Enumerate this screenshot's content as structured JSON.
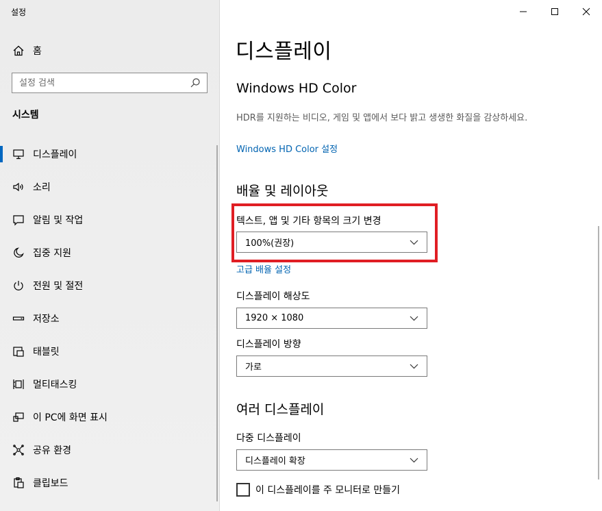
{
  "window": {
    "title": "설정"
  },
  "sidebar": {
    "home_label": "홈",
    "search_placeholder": "설정 검색",
    "section_title": "시스템",
    "items": [
      {
        "label": "디스플레이",
        "icon": "monitor-icon",
        "active": true
      },
      {
        "label": "소리",
        "icon": "speaker-icon"
      },
      {
        "label": "알림 및 작업",
        "icon": "notification-icon"
      },
      {
        "label": "집중 지원",
        "icon": "moon-icon"
      },
      {
        "label": "전원 및 절전",
        "icon": "power-icon"
      },
      {
        "label": "저장소",
        "icon": "storage-icon"
      },
      {
        "label": "태블릿",
        "icon": "tablet-icon"
      },
      {
        "label": "멀티태스킹",
        "icon": "multitasking-icon"
      },
      {
        "label": "이 PC에 화면 표시",
        "icon": "project-icon"
      },
      {
        "label": "공유 환경",
        "icon": "shared-experiences-icon"
      },
      {
        "label": "클립보드",
        "icon": "clipboard-icon"
      }
    ]
  },
  "main": {
    "page_title": "디스플레이",
    "hd_color": {
      "header": "Windows HD Color",
      "description": "HDR를 지원하는 비디오, 게임 및 앱에서 보다 밝고 생생한 화질을 감상하세요.",
      "link": "Windows HD Color 설정"
    },
    "scale_layout": {
      "header": "배율 및 레이아웃",
      "scale_label": "텍스트, 앱 및 기타 항목의 크기 변경",
      "scale_value": "100%(권장)",
      "advanced_link": "고급 배율 설정",
      "resolution_label": "디스플레이 해상도",
      "resolution_value": "1920 × 1080",
      "orientation_label": "디스플레이 방향",
      "orientation_value": "가로"
    },
    "multi_display": {
      "header": "여러 디스플레이",
      "label": "다중 디스플레이",
      "value": "디스플레이 확장",
      "checkbox_label": "이 디스플레이를 주 모니터로 만들기",
      "checkbox_checked": false
    }
  },
  "colors": {
    "accent": "#0067c0",
    "link": "#0063b1",
    "highlight": "#e01e24"
  }
}
